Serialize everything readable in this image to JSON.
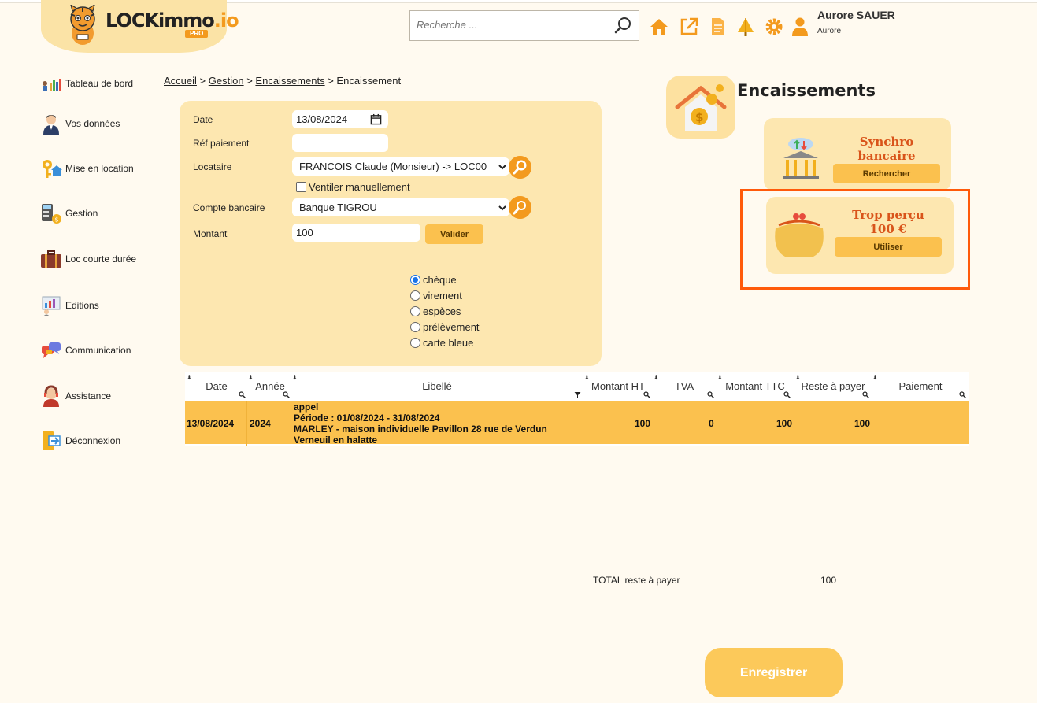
{
  "header": {
    "logo_text": "LOCKimmo",
    "logo_suffix": ".io",
    "logo_badge": "PRO",
    "search_placeholder": "Recherche ...",
    "user_name": "Aurore SAUER",
    "user_sub": "Aurore",
    "icons": [
      "home-icon",
      "external-link-icon",
      "document-icon",
      "tree-icon",
      "gear-icon",
      "user-icon"
    ]
  },
  "sidebar": {
    "items": [
      {
        "label": "Tableau de bord",
        "icon": "dashboard-icon"
      },
      {
        "label": "Vos données",
        "icon": "person-icon"
      },
      {
        "label": "Mise en location",
        "icon": "key-house-icon"
      },
      {
        "label": "Gestion",
        "icon": "calculator-icon"
      },
      {
        "label": "Loc courte durée",
        "icon": "suitcase-icon"
      },
      {
        "label": "Editions",
        "icon": "report-icon"
      },
      {
        "label": "Communication",
        "icon": "chat-icon"
      },
      {
        "label": "Assistance",
        "icon": "support-icon"
      },
      {
        "label": "Déconnexion",
        "icon": "logout-icon"
      }
    ]
  },
  "breadcrumb": {
    "items": [
      "Accueil",
      "Gestion",
      "Encaissements"
    ],
    "current": "Encaissement",
    "sep": ">"
  },
  "form": {
    "date_label": "Date",
    "date_value": "13/08/2024",
    "ref_label": "Réf paiement",
    "ref_value": "",
    "locataire_label": "Locataire",
    "locataire_value": "FRANCOIS Claude (Monsieur) -> LOC00",
    "ventiler_label": "Ventiler manuellement",
    "compte_label": "Compte bancaire",
    "compte_value": "Banque TIGROU",
    "montant_label": "Montant",
    "montant_value": "100",
    "valider_label": "Valider",
    "payment_methods": [
      "chèque",
      "virement",
      "espèces",
      "prélèvement",
      "carte bleue"
    ],
    "payment_selected": "chèque"
  },
  "right": {
    "title": "Encaissements",
    "synchro_title_1": "Synchro",
    "synchro_title_2": "bancaire",
    "synchro_button": "Rechercher",
    "trop_title": "Trop perçu",
    "trop_amount": "100 €",
    "trop_button": "Utiliser"
  },
  "table": {
    "columns": [
      "Date",
      "Année",
      "Libellé",
      "Montant HT",
      "TVA",
      "Montant TTC",
      "Reste à payer",
      "Paiement"
    ],
    "rows": [
      {
        "date": "13/08/2024",
        "annee": "2024",
        "libelle_1": "appel",
        "libelle_2": "Période : 01/08/2024 - 31/08/2024",
        "libelle_3": "MARLEY - maison individuelle Pavillon 28 rue de Verdun",
        "libelle_4": "Verneuil en halatte",
        "montant_ht": "100",
        "tva": "0",
        "montant_ttc": "100",
        "reste": "100",
        "paiement": ""
      }
    ]
  },
  "totals": {
    "label": "TOTAL reste à payer",
    "value": "100"
  },
  "save_label": "Enregistrer",
  "colors": {
    "accent": "#f39a1e",
    "panel": "#fde7b0",
    "row": "#fbc14e",
    "highlight": "#ff5a0a",
    "card_title": "#d9541a"
  }
}
